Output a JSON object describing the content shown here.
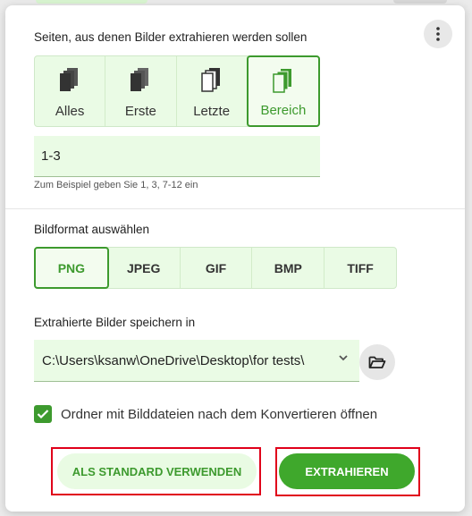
{
  "pages_section": {
    "label": "Seiten, aus denen Bilder extrahieren werden sollen",
    "options": [
      {
        "label": "Alles",
        "icon": "pages-all-icon",
        "active": false
      },
      {
        "label": "Erste",
        "icon": "pages-first-icon",
        "active": false
      },
      {
        "label": "Letzte",
        "icon": "pages-last-icon",
        "active": false
      },
      {
        "label": "Bereich",
        "icon": "pages-range-icon",
        "active": true
      }
    ],
    "range_value": "1-3",
    "hint": "Zum Beispiel geben Sie 1, 3, 7-12 ein"
  },
  "format_section": {
    "label": "Bildformat auswählen",
    "options": [
      "PNG",
      "JPEG",
      "GIF",
      "BMP",
      "TIFF"
    ],
    "selected": "PNG"
  },
  "save_section": {
    "label": "Extrahierte Bilder speichern in",
    "path": "C:\\Users\\ksanw\\OneDrive\\Desktop\\for tests\\"
  },
  "open_folder": {
    "checked": true,
    "label": "Ordner mit Bilddateien nach dem Konvertieren öffnen"
  },
  "buttons": {
    "default_label": "ALS STANDARD VERWENDEN",
    "extract_label": "EXTRAHIEREN"
  },
  "colors": {
    "accent": "#3d9a2e",
    "light_green": "#eafbe5",
    "highlight_red": "#e0001a"
  }
}
